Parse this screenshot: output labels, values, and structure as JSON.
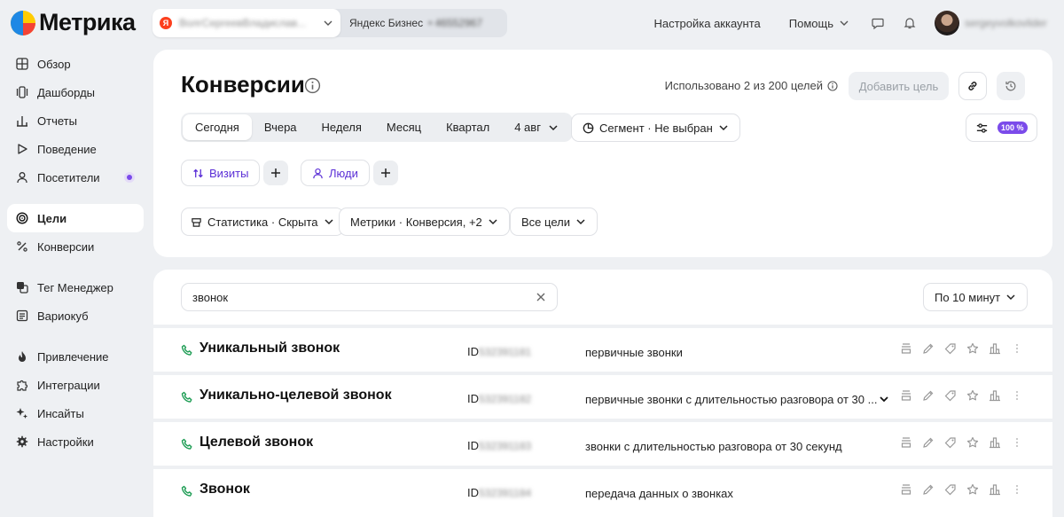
{
  "brand": {
    "name": "Метрика"
  },
  "account": {
    "current": "ВолгСергеевВладислав...",
    "business_label": "Яндекс Бизнес",
    "business_id": "•  46552967"
  },
  "topbar": {
    "settings": "Настройка аккаунта",
    "help": "Помощь",
    "user": "sergeyvolkovlider"
  },
  "sidebar": {
    "items": [
      {
        "label": "Обзор",
        "icon": "grid-icon"
      },
      {
        "label": "Дашборды",
        "icon": "dashboards-icon"
      },
      {
        "label": "Отчеты",
        "icon": "bar-chart-icon"
      },
      {
        "label": "Поведение",
        "icon": "play-icon"
      },
      {
        "label": "Посетители",
        "icon": "user-icon"
      },
      {
        "label": "Цели",
        "icon": "target-icon",
        "active": true
      },
      {
        "label": "Конверсии",
        "icon": "percent-icon"
      },
      {
        "label": "Тег Менеджер",
        "icon": "tag-manager-icon"
      },
      {
        "label": "Вариокуб",
        "icon": "variocube-icon"
      },
      {
        "label": "Привлечение",
        "icon": "flame-icon"
      },
      {
        "label": "Интеграции",
        "icon": "puzzle-icon"
      },
      {
        "label": "Инсайты",
        "icon": "sparkles-icon"
      },
      {
        "label": "Настройки",
        "icon": "gear-icon"
      }
    ]
  },
  "header": {
    "title": "Конверсии",
    "usage": "Использовано 2 из 200 целей",
    "add_goal": "Добавить цель",
    "periods": [
      "Сегодня",
      "Вчера",
      "Неделя",
      "Месяц",
      "Квартал"
    ],
    "date": "4 авг",
    "segment": "Сегмент · Не выбран",
    "sampling": "100 %",
    "visits": "Визиты",
    "people": "Люди",
    "statistics": "Статистика · Скрыта",
    "metrics": "Метрики · Конверсия, +2",
    "all_goals": "Все цели"
  },
  "list": {
    "search_value": "звонок",
    "interval": "По 10 минут",
    "rows": [
      {
        "name": "Уникальный звонок",
        "id_prefix": "ID",
        "id": "532391181",
        "desc": "первичные звонки"
      },
      {
        "name": "Уникально-целевой звонок",
        "id_prefix": "ID",
        "id": "532391182",
        "desc": "первичные звонки с длительностью разговора от 30 ..."
      },
      {
        "name": "Целевой звонок",
        "id_prefix": "ID",
        "id": "532391183",
        "desc": "звонки с длительностью разговора от 30 секунд"
      },
      {
        "name": "Звонок",
        "id_prefix": "ID",
        "id": "532391184",
        "desc": "передача данных о звонках"
      }
    ]
  },
  "colors": {
    "accent": "#7b4bea",
    "phone": "#1f9d55",
    "background": "#eef0f3"
  }
}
